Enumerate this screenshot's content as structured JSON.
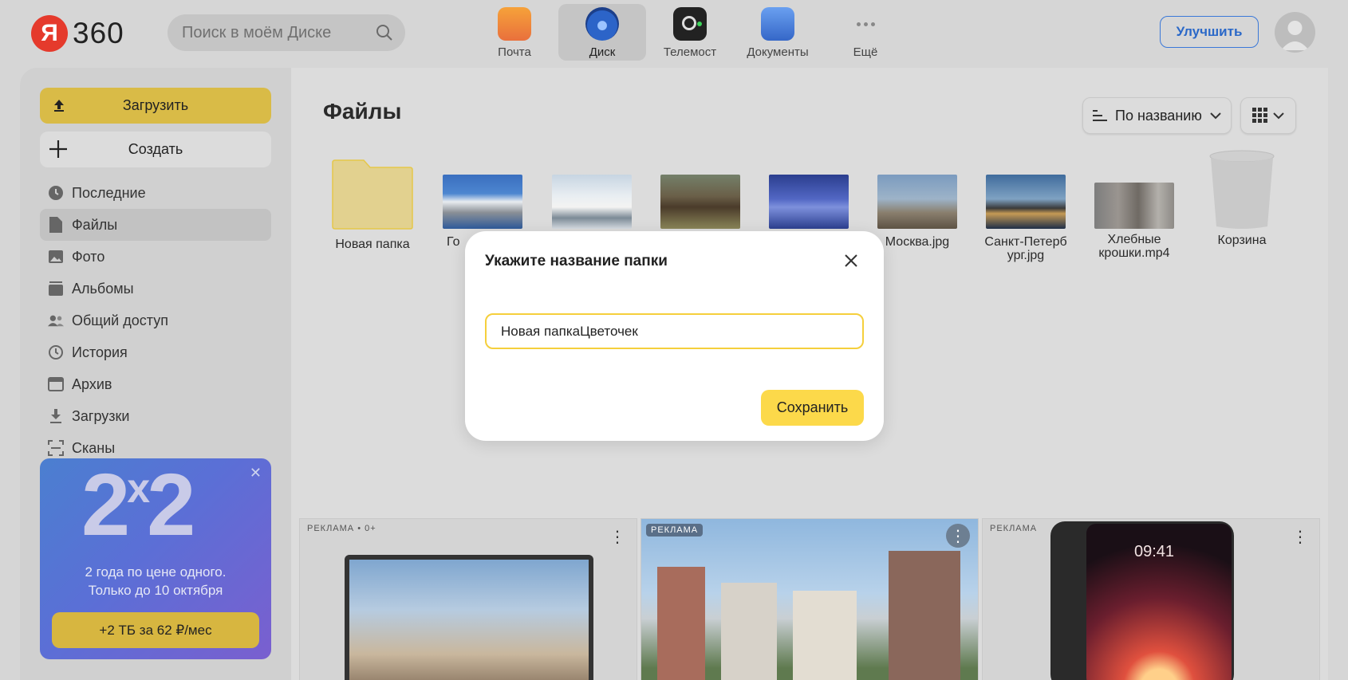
{
  "header": {
    "logo_mark": "Я",
    "logo_text": "360",
    "search_placeholder": "Поиск в моём Диске",
    "apps": [
      {
        "label": "Почта",
        "icon": "mail-icon",
        "active": false
      },
      {
        "label": "Диск",
        "icon": "disk-icon",
        "active": true
      },
      {
        "label": "Телемост",
        "icon": "telemost-icon",
        "active": false
      },
      {
        "label": "Документы",
        "icon": "documents-icon",
        "active": false
      },
      {
        "label": "Ещё",
        "icon": "more-icon",
        "active": false
      }
    ],
    "upgrade_label": "Улучшить"
  },
  "sidebar": {
    "upload_label": "Загрузить",
    "create_label": "Создать",
    "nav": [
      {
        "label": "Последние",
        "icon": "clock-icon"
      },
      {
        "label": "Файлы",
        "icon": "file-icon",
        "active": true
      },
      {
        "label": "Фото",
        "icon": "photo-icon"
      },
      {
        "label": "Альбомы",
        "icon": "albums-icon"
      },
      {
        "label": "Общий доступ",
        "icon": "people-icon"
      },
      {
        "label": "История",
        "icon": "history-icon"
      },
      {
        "label": "Архив",
        "icon": "archive-icon"
      },
      {
        "label": "Загрузки",
        "icon": "download-icon"
      },
      {
        "label": "Сканы",
        "icon": "scan-icon"
      }
    ],
    "promo": {
      "big_text": "2",
      "big_sup": "x",
      "big_text2": "2",
      "line1": "2 года по цене одного.",
      "line2": "Только до 10 октября",
      "button": "+2 ТБ  за 62 ₽/мес"
    }
  },
  "main": {
    "title": "Файлы",
    "sort_label": "По названию",
    "files": [
      {
        "name": "Новая папка",
        "type": "folder"
      },
      {
        "name": "Го",
        "type": "image"
      },
      {
        "name": "",
        "type": "image"
      },
      {
        "name": "",
        "type": "image"
      },
      {
        "name": "",
        "type": "image"
      },
      {
        "name": "Москва.jpg",
        "type": "image"
      },
      {
        "name": "Санкт-Петербург.jpg",
        "name_l1": "Санкт-Петерб",
        "name_l2": "ург.jpg",
        "type": "image"
      },
      {
        "name": "Хлебные крошки.mp4",
        "name_l1": "Хлебные",
        "name_l2": "крошки.mp4",
        "type": "video"
      },
      {
        "name": "Корзина",
        "type": "trash"
      }
    ],
    "ads": [
      {
        "label": "РЕКЛАМА • 0+"
      },
      {
        "label": "РЕКЛАМА"
      },
      {
        "label": "РЕКЛАМА",
        "clock": "09:41"
      }
    ]
  },
  "modal": {
    "title": "Укажите название папки",
    "input_value": "Новая папкаЦветочек",
    "save_label": "Сохранить"
  }
}
